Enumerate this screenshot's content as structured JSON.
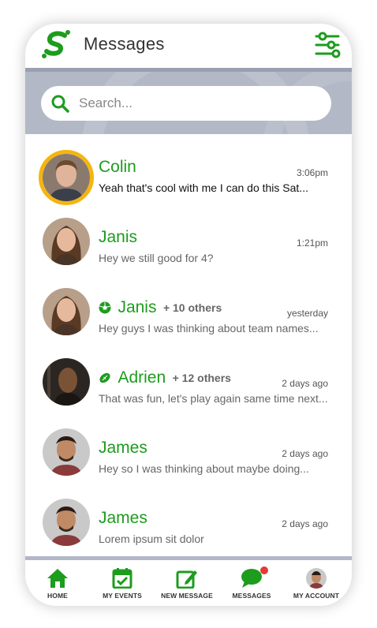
{
  "header": {
    "title": "Messages"
  },
  "search": {
    "placeholder": "Search..."
  },
  "conversations": [
    {
      "name": "Colin",
      "others": "",
      "time": "3:06pm",
      "preview": "Yeah that's cool with me I can do this Sat...",
      "unread": true,
      "group_icon": ""
    },
    {
      "name": "Janis",
      "others": "",
      "time": "1:21pm",
      "preview": "Hey we still good for 4?",
      "unread": false,
      "group_icon": ""
    },
    {
      "name": "Janis",
      "others": "+ 10 others",
      "time": "yesterday",
      "preview": "Hey guys I was thinking about team names...",
      "unread": false,
      "group_icon": "soccer-ball-icon"
    },
    {
      "name": "Adrien",
      "others": "+ 12 others",
      "time": "2 days ago",
      "preview": "That was fun, let's play again same time next...",
      "unread": false,
      "group_icon": "football-icon"
    },
    {
      "name": "James",
      "others": "",
      "time": "2 days ago",
      "preview": "Hey so I was thinking about maybe doing...",
      "unread": false,
      "group_icon": ""
    },
    {
      "name": "James",
      "others": "",
      "time": "2 days ago",
      "preview": "Lorem ipsum sit dolor",
      "unread": false,
      "group_icon": ""
    }
  ],
  "nav": [
    {
      "label": "HOME",
      "icon": "home-icon"
    },
    {
      "label": "MY EVENTS",
      "icon": "calendar-check-icon"
    },
    {
      "label": "NEW MESSAGE",
      "icon": "compose-icon"
    },
    {
      "label": "MESSAGES",
      "icon": "chat-bubble-icon",
      "notification": true
    },
    {
      "label": "MY ACCOUNT",
      "icon": "avatar"
    }
  ],
  "colors": {
    "brand_green": "#1d9c1d",
    "unread_ring": "#f5b50f",
    "notification_dot": "#e53935",
    "hero_bg": "#b3b8c6"
  }
}
